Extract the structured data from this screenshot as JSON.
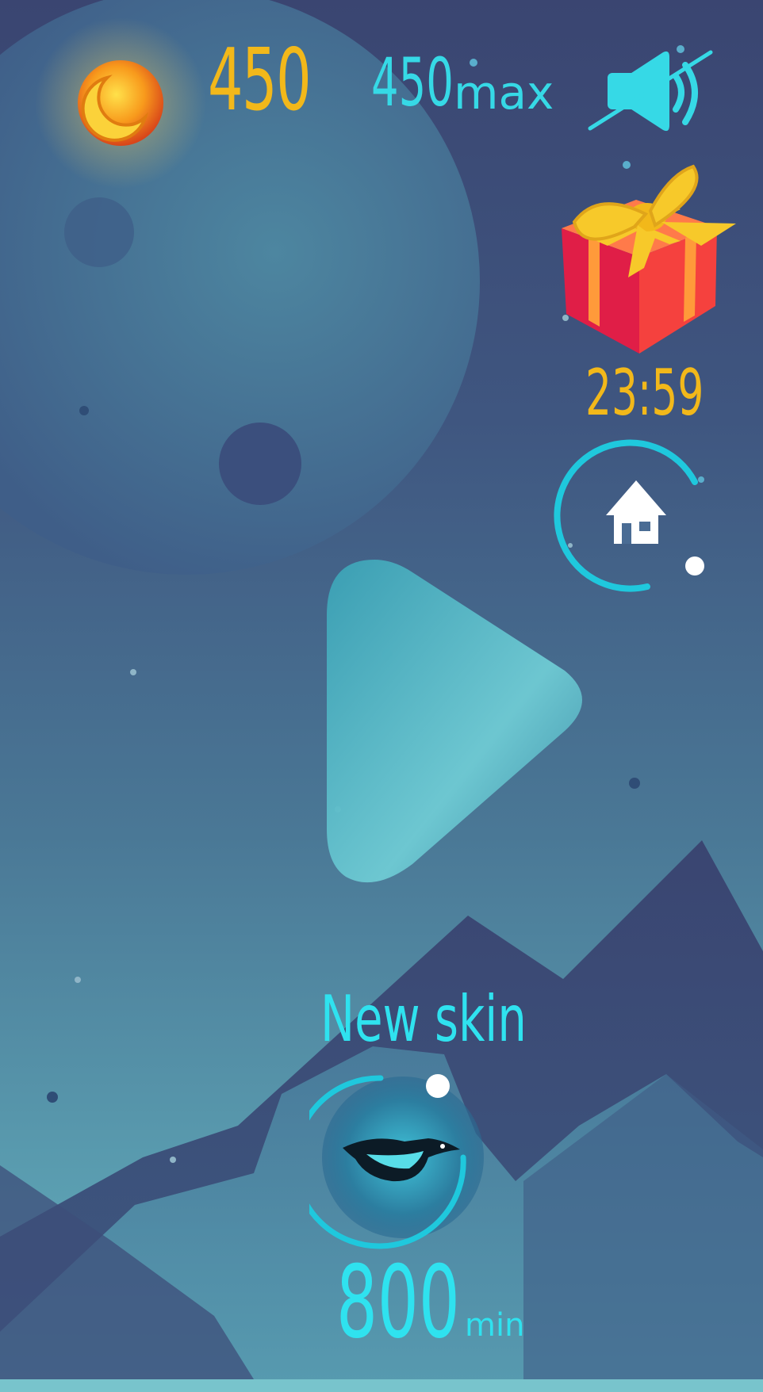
{
  "hud": {
    "coin_count": "450",
    "max_score": "450",
    "max_suffix": "max"
  },
  "gift": {
    "timer": "23:59"
  },
  "skin_offer": {
    "title": "New skin",
    "price": "800",
    "price_unit": "min"
  },
  "icons": {
    "coin": "coin-icon",
    "sound": "sound-off-icon",
    "gift": "gift-icon",
    "home": "home-icon",
    "play": "play-icon",
    "skin": "bird-skin-icon"
  },
  "colors": {
    "gold": "#f2b81a",
    "cyan": "#36d9e6",
    "bg_top": "#3a4571",
    "bg_bottom": "#6cb6c2"
  }
}
